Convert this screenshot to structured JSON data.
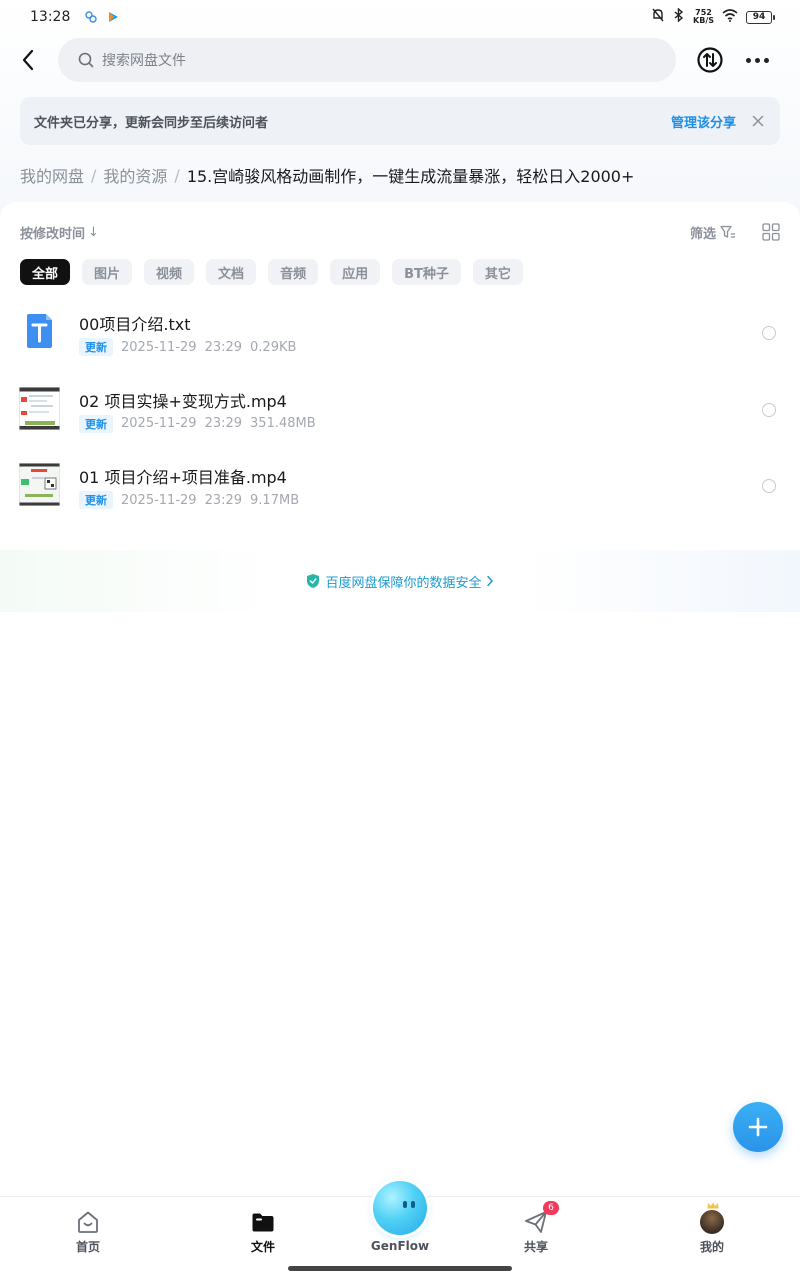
{
  "status_bar": {
    "time": "13:28",
    "net_speed_value": "752",
    "net_speed_unit": "KB/S",
    "battery": "94"
  },
  "header": {
    "search_placeholder": "搜索网盘文件"
  },
  "share_banner": {
    "message": "文件夹已分享，更新会同步至后续访问者",
    "manage_label": "管理该分享"
  },
  "breadcrumb": {
    "items": [
      "我的网盘",
      "我的资源"
    ],
    "current": "15.宫崎骏风格动画制作，一键生成流量暴涨，轻松日入2000+"
  },
  "toolbar": {
    "sort_label": "按修改时间",
    "sort_arrow": "↓",
    "filter_label": "筛选"
  },
  "categories": [
    "全部",
    "图片",
    "视频",
    "文档",
    "音频",
    "应用",
    "BT种子",
    "其它"
  ],
  "files": [
    {
      "name": "00项目介绍.txt",
      "tag": "更新",
      "date": "2025-11-29",
      "time": "23:29",
      "size": "0.29KB",
      "type": "txt"
    },
    {
      "name": "02 项目实操+变现方式.mp4",
      "tag": "更新",
      "date": "2025-11-29",
      "time": "23:29",
      "size": "351.48MB",
      "type": "video"
    },
    {
      "name": "01 项目介绍+项目准备.mp4",
      "tag": "更新",
      "date": "2025-11-29",
      "time": "23:29",
      "size": "9.17MB",
      "type": "video"
    }
  ],
  "security_notice": "百度网盘保障你的数据安全",
  "bottom_nav": {
    "home": "首页",
    "files": "文件",
    "genflow": "GenFlow",
    "share": "共享",
    "share_badge": "6",
    "mine": "我的"
  },
  "colors": {
    "accent": "#1f8fe8",
    "badge": "#f23b5c",
    "chip_active": "#111111"
  }
}
